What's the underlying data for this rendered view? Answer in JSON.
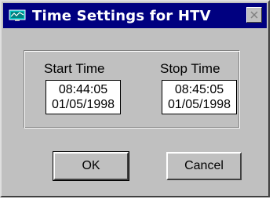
{
  "window": {
    "title": "Time Settings for HTV",
    "icon": "monitor-app-icon",
    "close_icon": "close-icon"
  },
  "start": {
    "label": "Start Time",
    "time": "08:44:05",
    "date": "01/05/1998"
  },
  "stop": {
    "label": "Stop Time",
    "time": "08:45:05",
    "date": "01/05/1998"
  },
  "buttons": {
    "ok": "OK",
    "cancel": "Cancel"
  },
  "colors": {
    "titlebar": "#000080",
    "face": "#c0c0c0"
  }
}
